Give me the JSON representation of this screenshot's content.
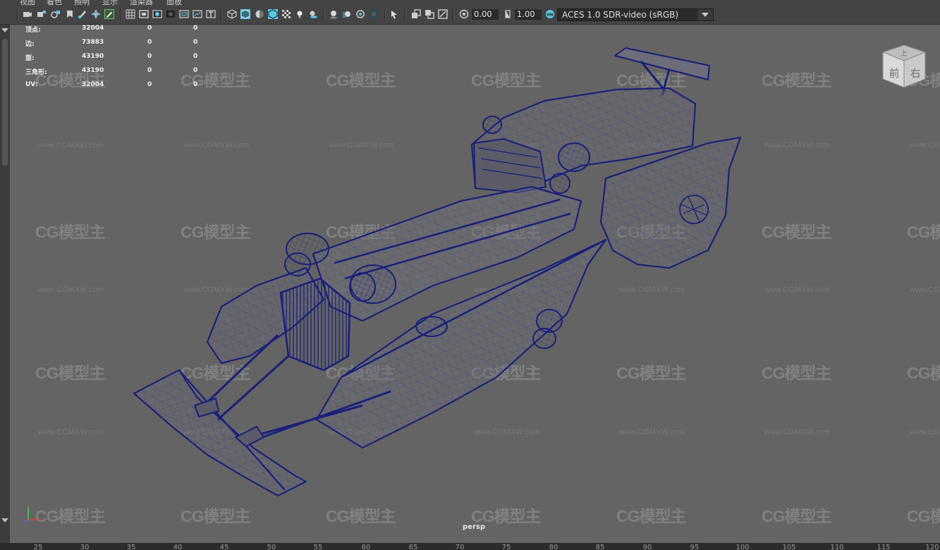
{
  "menubar": {
    "items": [
      "视图",
      "着色",
      "照明",
      "显示",
      "渲染器",
      "面板"
    ]
  },
  "toolbar": {
    "gamma_value": "0.00",
    "exposure_value": "1.00",
    "color_management": "ACES 1.0 SDR-video (sRGB)",
    "icons": [
      "camera-icon",
      "camera-attr-icon",
      "bookmark-icon",
      "image-plane-icon",
      "grease-pencil-icon",
      "two-d-pan-icon",
      "grid-icon",
      "film-gate-icon",
      "resolution-gate-icon",
      "gate-mask-icon",
      "field-chart-icon",
      "safe-action-icon",
      "safe-title-icon",
      "wireframe-icon",
      "smooth-shade-icon",
      "default-material-icon",
      "xray-icon",
      "textured-icon",
      "lights-icon",
      "shadows-icon",
      "ambient-occlusion-icon",
      "motion-blur-icon",
      "anti-alias-icon",
      "depth-of-field-icon",
      "isolate-select-icon",
      "xray-joints-icon",
      "xray-active-icon",
      "backface-icon"
    ]
  },
  "hud": {
    "rows": [
      {
        "label": "顶点:",
        "v1": "32004",
        "v2": "0",
        "v3": "0"
      },
      {
        "label": "边:",
        "v1": "73883",
        "v2": "0",
        "v3": "0"
      },
      {
        "label": "面:",
        "v1": "43190",
        "v2": "0",
        "v3": "0"
      },
      {
        "label": "三角形:",
        "v1": "43190",
        "v2": "0",
        "v3": "0"
      },
      {
        "label": "UV:",
        "v1": "32004",
        "v2": "0",
        "v3": "0"
      }
    ]
  },
  "viewcube": {
    "top": "上",
    "front": "前",
    "right": "右"
  },
  "camera_label": "persp",
  "watermark": {
    "logo": "CG模型主",
    "url": "www.CGMXW.com"
  },
  "timeline": {
    "ticks": [
      "25",
      "30",
      "35",
      "40",
      "45",
      "50",
      "55",
      "60",
      "65",
      "70",
      "75",
      "80",
      "85",
      "90",
      "95",
      "100",
      "105",
      "110",
      "115",
      "120"
    ]
  },
  "colors": {
    "viewport_bg": "#646464",
    "wire": "#1a1f7a",
    "accent": "#5cc8e6"
  }
}
